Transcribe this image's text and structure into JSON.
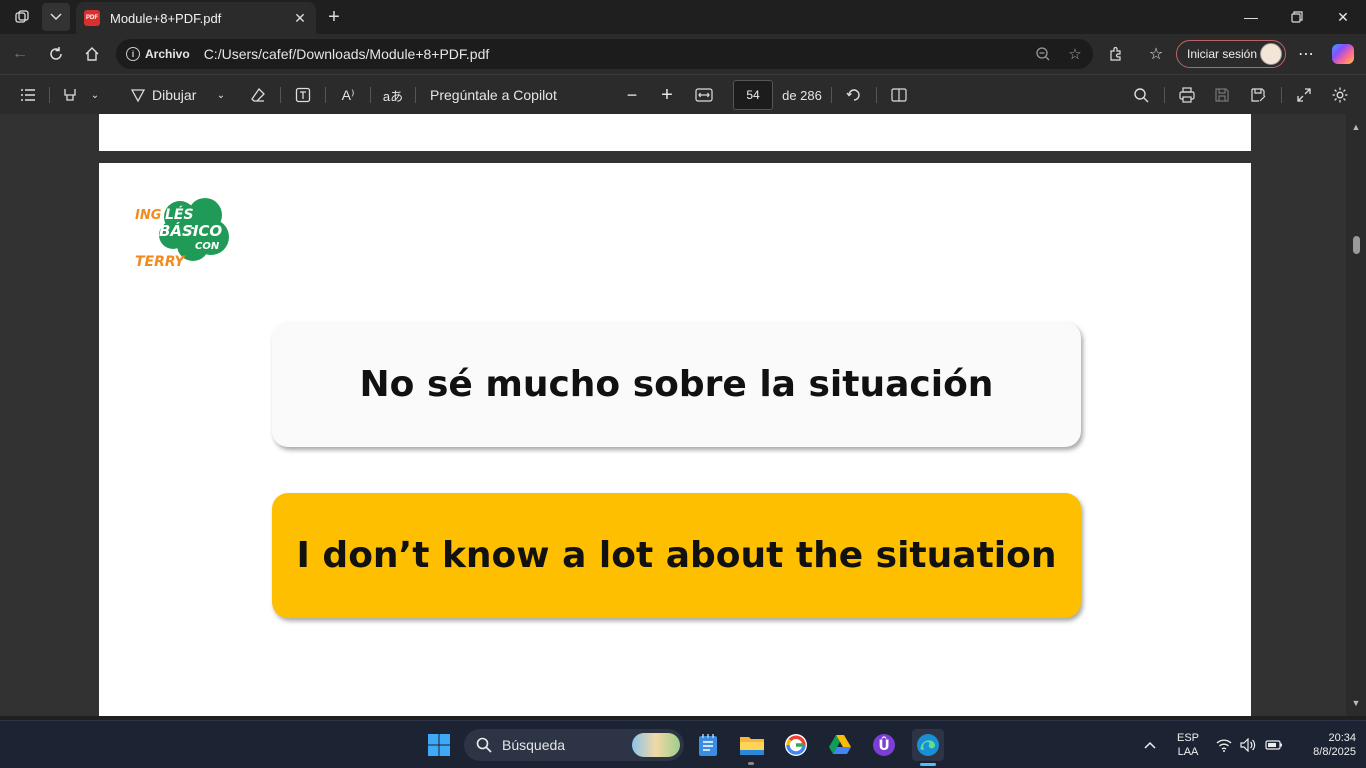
{
  "browser": {
    "tab_title": "Module+8+PDF.pdf",
    "tab_badge": "PDF",
    "site_chip": "Archivo",
    "url": "C:/Users/cafef/Downloads/Module+8+PDF.pdf",
    "signin_label": "Iniciar sesión"
  },
  "pdf_toolbar": {
    "draw_label": "Dibujar",
    "copilot_label": "Pregúntale a Copilot",
    "page_current": "54",
    "page_total": "de 286"
  },
  "page": {
    "logo_text": {
      "line1": "INGLÉS",
      "line2": "BÁSICO",
      "line3": "CON",
      "line4": "TERRY"
    },
    "card1_text": "No sé mucho sobre la situación",
    "card2_text": "I don’t know a lot about the situation"
  },
  "taskbar": {
    "search_placeholder": "Búsqueda",
    "lang_line1": "ESP",
    "lang_line2": "LAA",
    "time": "20:34",
    "date": "8/8/2025"
  },
  "colors": {
    "card_yellow": "#fdbf00",
    "logo_green": "#1f9b57",
    "logo_orange": "#f28a1d"
  }
}
